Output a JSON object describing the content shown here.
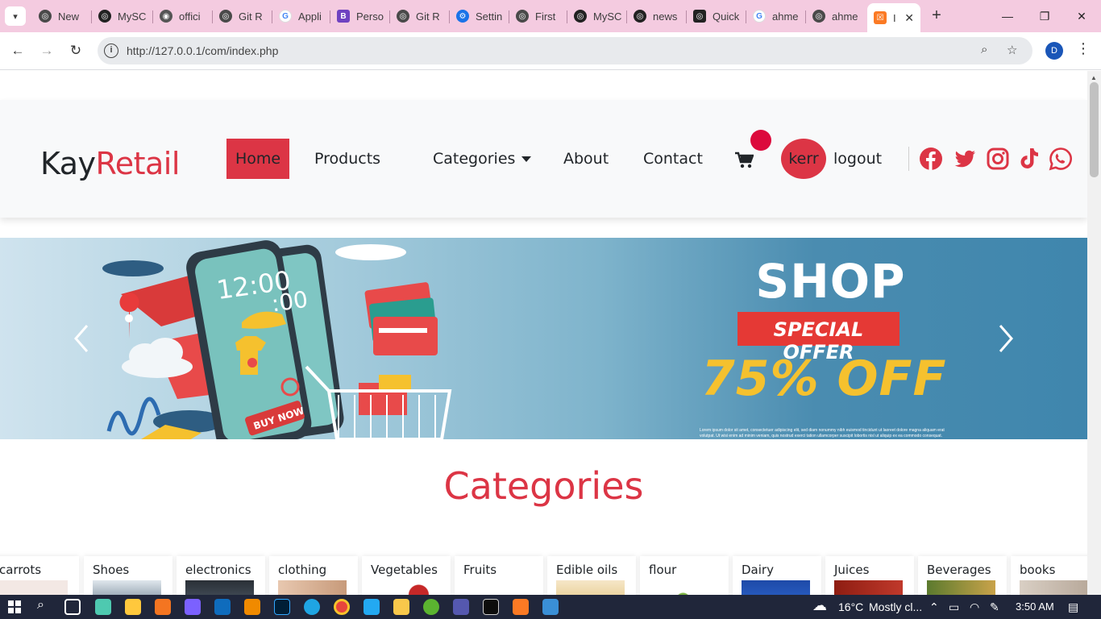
{
  "browser": {
    "tabs": [
      {
        "label": "New",
        "favicon": "chatgpt-icon"
      },
      {
        "label": "MySC",
        "favicon": "chatgpt-icon"
      },
      {
        "label": "offici",
        "favicon": "github-icon"
      },
      {
        "label": "Git R",
        "favicon": "chatgpt-icon"
      },
      {
        "label": "Appli",
        "favicon": "google-icon"
      },
      {
        "label": "Perso",
        "favicon": "bootstrap-icon"
      },
      {
        "label": "Git R",
        "favicon": "chatgpt-icon"
      },
      {
        "label": "Settin",
        "favicon": "settings-icon"
      },
      {
        "label": "First",
        "favicon": "chatgpt-icon"
      },
      {
        "label": "MySC",
        "favicon": "chatgpt-icon"
      },
      {
        "label": "news",
        "favicon": "chatgpt-icon"
      },
      {
        "label": "Quick",
        "favicon": "chatgpt-icon"
      },
      {
        "label": "ahme",
        "favicon": "google-icon"
      },
      {
        "label": "ahme",
        "favicon": "chatgpt-icon"
      },
      {
        "label": "I",
        "favicon": "xampp-icon"
      }
    ],
    "url": "http://127.0.0.1/com/index.php",
    "profile_initial": "D"
  },
  "navbar": {
    "brand_dark": "Kay",
    "brand_accent": "Retail",
    "links": {
      "home": "Home",
      "products": "Products",
      "categories": "Categories",
      "about": "About",
      "contact": "Contact"
    },
    "user": "kerr",
    "logout": "logout"
  },
  "banner": {
    "headline": "SHOP",
    "tag": "SPECIAL OFFER",
    "discount": "75% OFF",
    "fine_print": "Lorem ipsum dolor sit amet, consectetuer adipiscing elit, sed diam nonummy nibh euismod tincidunt ut laoreet dolore magna aliquam erat volutpat. Ut wisi enim ad minim veniam, quis nostrud exerci tation ullamcorper suscipit lobortis nisl ut aliquip ex ea commodo consequat. Duis autem vel eum"
  },
  "categories": {
    "title": "Categories",
    "items": [
      "carrots",
      "Shoes",
      "electronics",
      "clothing",
      "Vegetables",
      "Fruits",
      "Edible oils",
      "flour",
      "Dairy",
      "Juices",
      "Beverages",
      "books"
    ]
  },
  "taskbar": {
    "temperature": "16°C",
    "weather": "Mostly cl...",
    "time": "3:50 AM"
  },
  "colors": {
    "accent": "#dc3545",
    "tabbar": "#f4cbe0",
    "taskbar": "#20263a",
    "discount": "#f5c12e"
  }
}
